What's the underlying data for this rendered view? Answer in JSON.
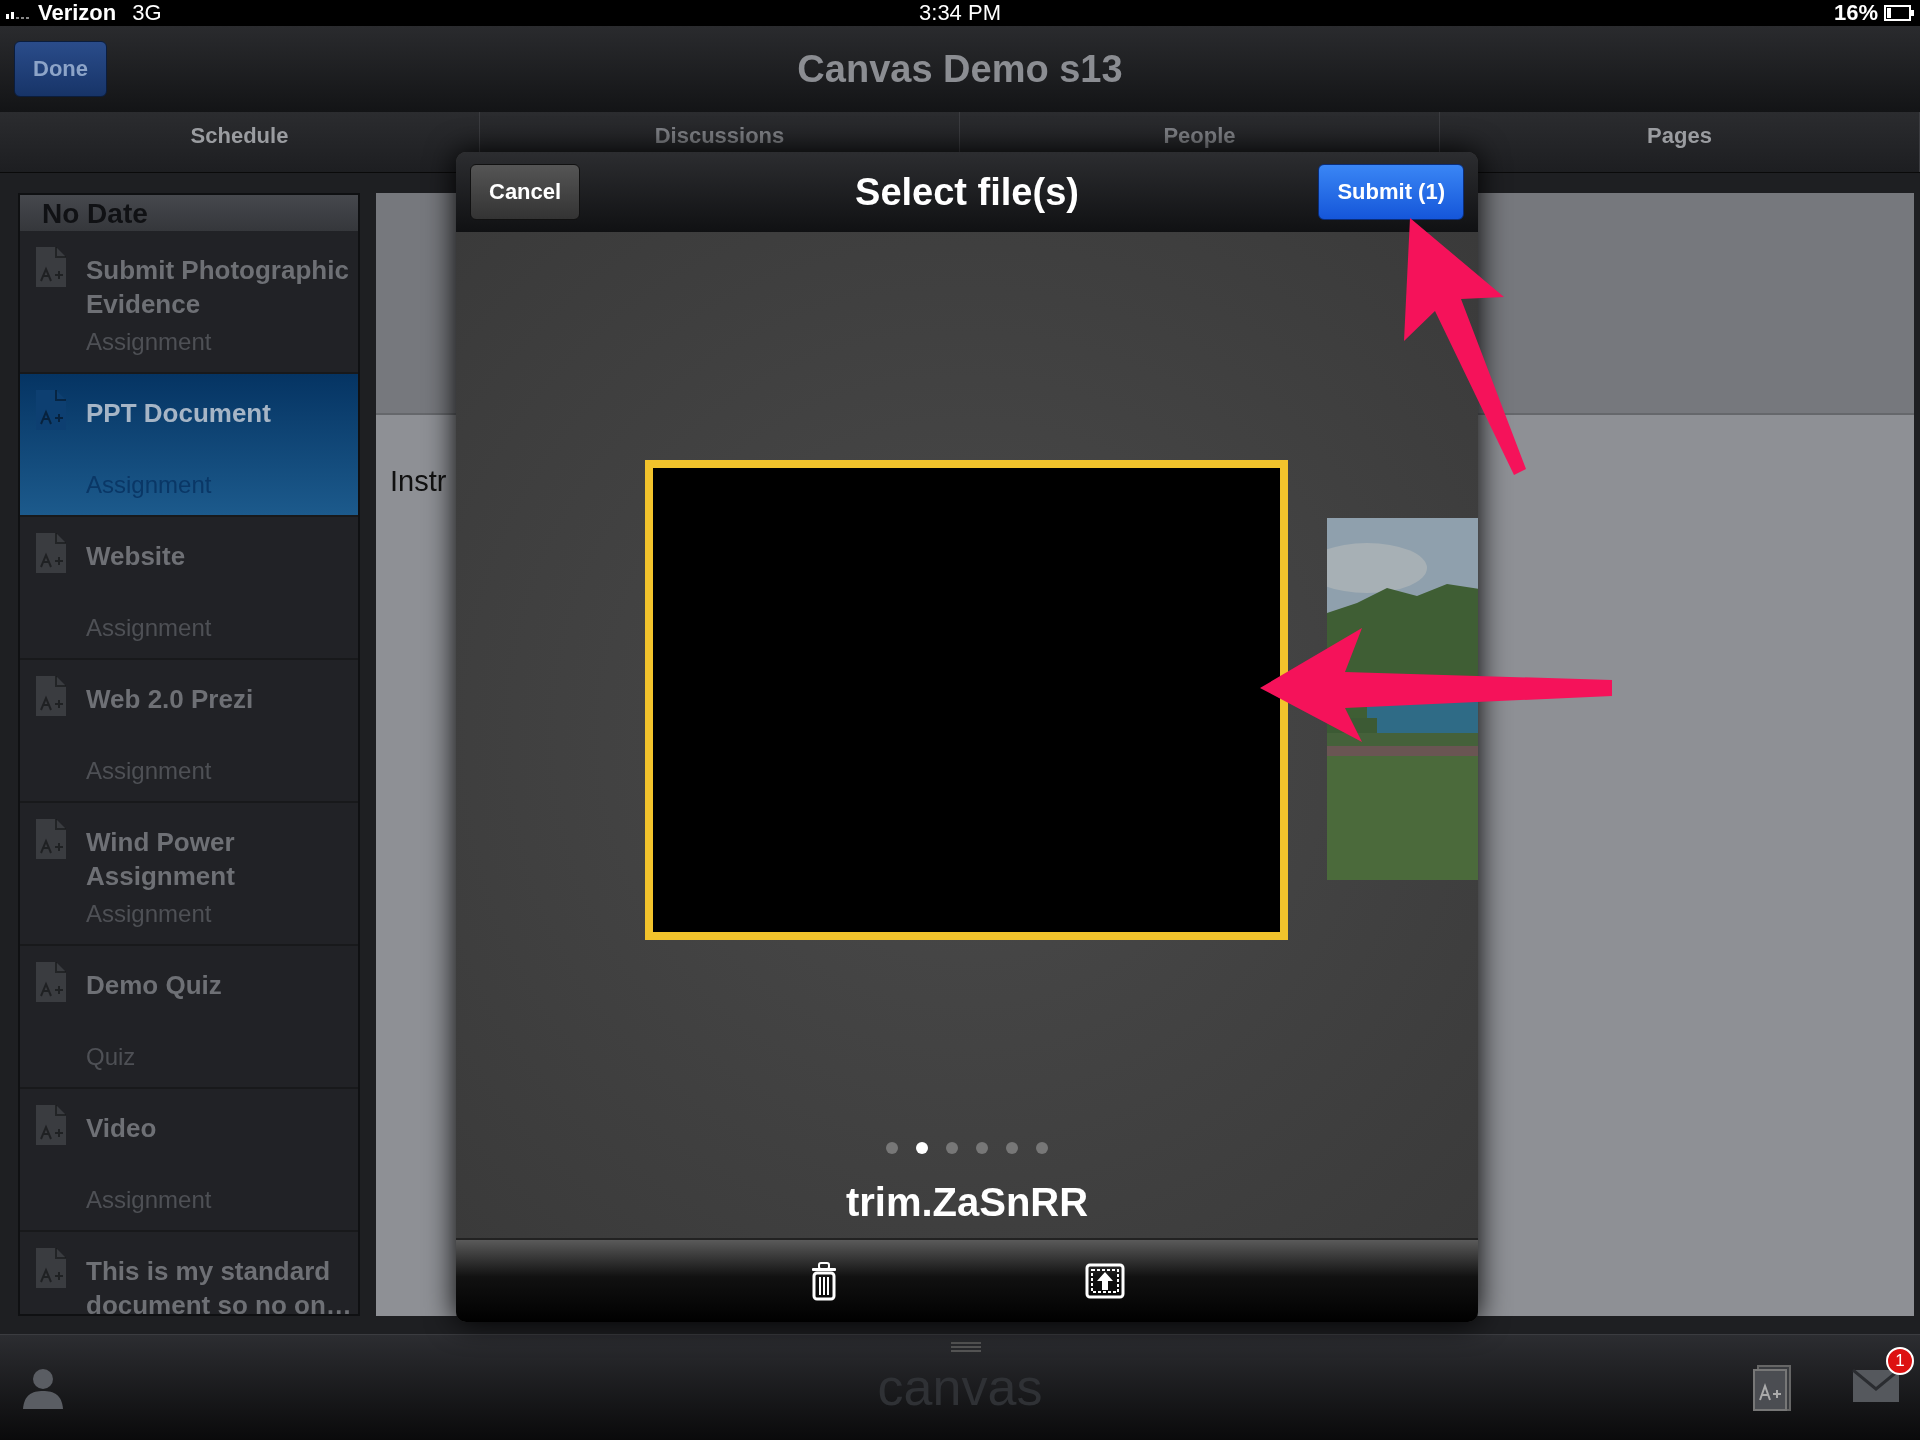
{
  "status_bar": {
    "carrier": "Verizon",
    "network": "3G",
    "time": "3:34 PM",
    "battery": "16%"
  },
  "nav_bar": {
    "title": "Canvas Demo s13",
    "done_button": "Done"
  },
  "tabs": [
    {
      "label": "Schedule",
      "selected": false
    },
    {
      "label": "Discussions",
      "selected": false
    },
    {
      "label": "People",
      "selected": false
    },
    {
      "label": "Pages",
      "selected": false
    }
  ],
  "sidebar": {
    "header": "No Date",
    "items": [
      {
        "title": "Submit Photographic Evidence",
        "type": "Assignment",
        "selected": false
      },
      {
        "title": "PPT Document",
        "type": "Assignment",
        "selected": true
      },
      {
        "title": "Website",
        "type": "Assignment",
        "selected": false
      },
      {
        "title": "Web 2.0 Prezi",
        "type": "Assignment",
        "selected": false
      },
      {
        "title": "Wind Power Assignment",
        "type": "Assignment",
        "selected": false
      },
      {
        "title": "Demo Quiz",
        "type": "Quiz",
        "selected": false
      },
      {
        "title": "Video",
        "type": "Assignment",
        "selected": false
      },
      {
        "title": "This is my standard document so no on…",
        "selected": false
      }
    ]
  },
  "main_panel": {
    "text": "Instr"
  },
  "dialog": {
    "title": "Select file(s)",
    "cancel_button": "Cancel",
    "submit_button": "Submit (1)",
    "file_name": "trim.ZaSnRR",
    "pages": [
      {
        "selected": false
      },
      {
        "selected": true
      },
      {
        "selected": false
      },
      {
        "selected": false
      },
      {
        "selected": false
      },
      {
        "selected": false
      }
    ]
  },
  "bottom_bar": {
    "logo": "canvas",
    "mail_badge": "1"
  }
}
